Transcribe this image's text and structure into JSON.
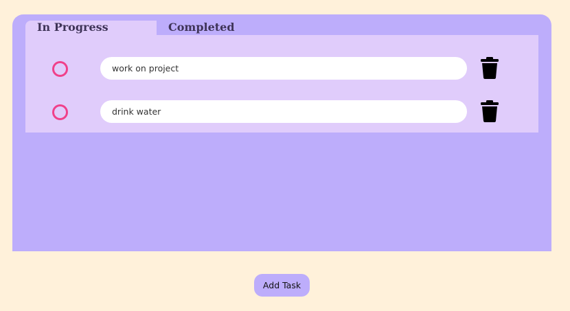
{
  "tabs": {
    "in_progress": "In Progress",
    "completed": "Completed"
  },
  "tasks": [
    {
      "text": "work on project",
      "done": false
    },
    {
      "text": "drink water",
      "done": false
    }
  ],
  "icons": {
    "check": "circle-outline-icon",
    "delete": "trash-icon"
  },
  "actions": {
    "add_task": "Add Task"
  },
  "colors": {
    "background": "#fff1da",
    "board": "#bdadfb",
    "panel": "#e0ccfb",
    "check_ring": "#f0408a"
  }
}
